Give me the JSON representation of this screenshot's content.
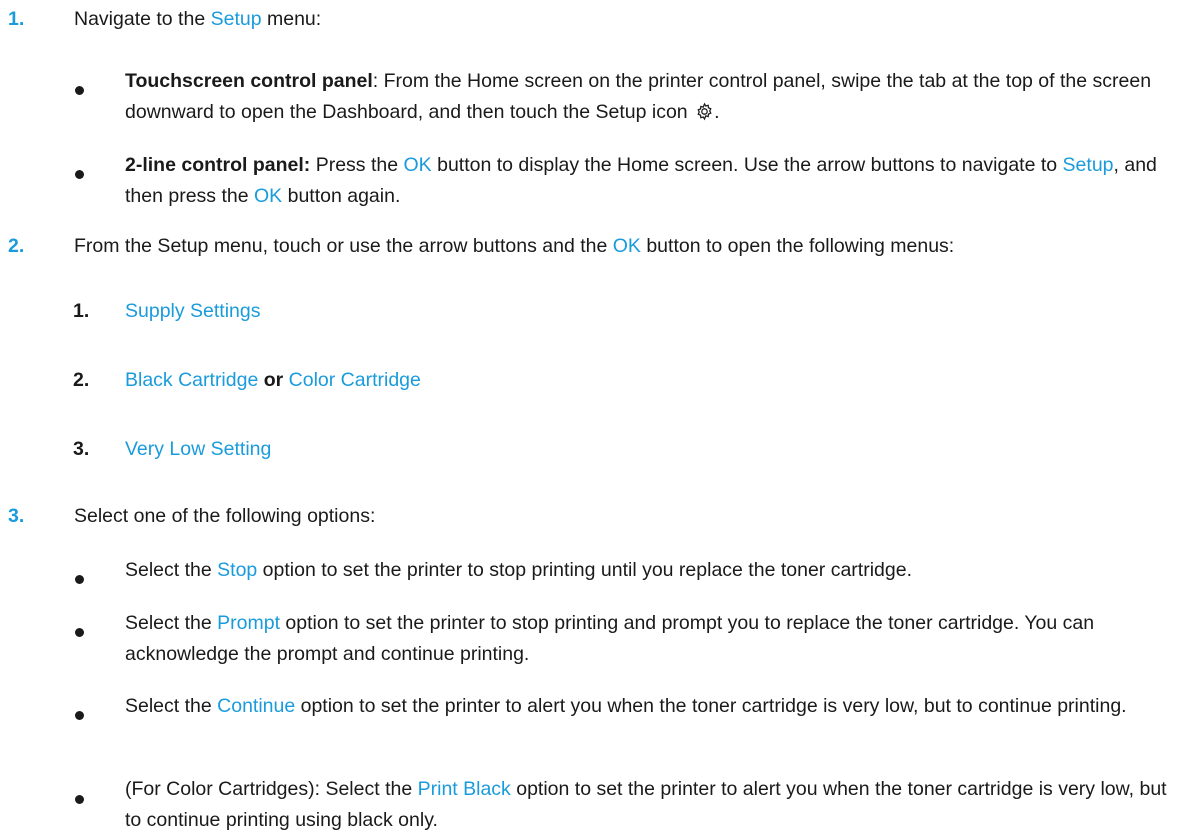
{
  "colors": {
    "ui_text": "#1a9bdc",
    "body_text": "#1a1a1a"
  },
  "steps": [
    {
      "num": "1.",
      "pre": "Navigate to the ",
      "ui": "Setup",
      "post": " menu:",
      "bullets": [
        {
          "bold": "Touchscreen control panel",
          "text": ": From the Home screen on the printer control panel, swipe the tab at the top of the screen downward to open the Dashboard, and then touch the Setup icon ",
          "icon": "gear-icon",
          "end": "."
        },
        {
          "bold": "2-line control panel:",
          "t1": " Press the ",
          "ui1": "OK",
          "t2": " button to display the Home screen. Use the arrow buttons to navigate to ",
          "ui2": "Setup",
          "t3": ", and then press the ",
          "ui3": "OK",
          "t4": " button again."
        }
      ]
    },
    {
      "num": "2.",
      "pre": "From the Setup menu, touch or use the arrow buttons and the ",
      "ui": "OK",
      "post": " button to open the following menus:",
      "substeps": [
        {
          "num": "1.",
          "ui": "Supply Settings"
        },
        {
          "num": "2.",
          "ui_a": "Black Cartridge",
          "or": " or ",
          "ui_b": "Color Cartridge"
        },
        {
          "num": "3.",
          "ui": "Very Low Setting"
        }
      ]
    },
    {
      "num": "3.",
      "text": "Select one of the following options:",
      "bullets": [
        {
          "pre": "Select the ",
          "ui": "Stop",
          "post": " option to set the printer to stop printing until you replace the toner cartridge."
        },
        {
          "pre": "Select the ",
          "ui": "Prompt",
          "post": " option to set the printer to stop printing and prompt you to replace the toner cartridge. You can acknowledge the prompt and continue printing."
        },
        {
          "pre": "Select the ",
          "ui": "Continue",
          "post": " option to set the printer to alert you when the toner cartridge is very low, but to continue printing."
        },
        {
          "pre": "(For Color Cartridges): Select the ",
          "ui": "Print Black",
          "post": " option to set the printer to alert you when the toner cartridge is very low, but to continue printing using black only."
        }
      ]
    }
  ]
}
